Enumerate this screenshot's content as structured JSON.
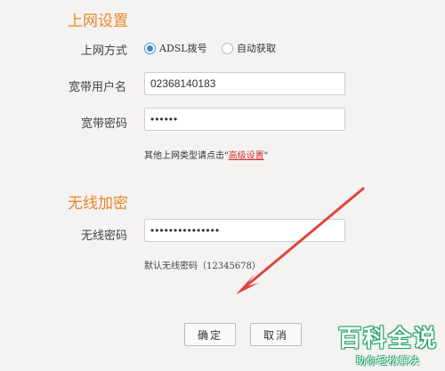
{
  "internet": {
    "title": "上网设置",
    "method_label": "上网方式",
    "option_adsl": "ADSL拨号",
    "option_auto": "自动获取",
    "selected": "ADSL拨号",
    "username_label": "宽带用户名",
    "username_value": "02368140183",
    "password_label": "宽带密码",
    "password_value": "••••••",
    "hint_prefix": "其他上网类型请点击\"",
    "hint_link": "高级设置",
    "hint_suffix": "\""
  },
  "wireless": {
    "title": "无线加密",
    "password_label": "无线密码",
    "password_value": "•••••••••••••••",
    "default_hint": "默认无线密码（12345678）"
  },
  "buttons": {
    "ok": "确定",
    "cancel": "取消"
  },
  "watermark": {
    "title": "百科全说",
    "subtitle": "助你轻松解决"
  },
  "colors": {
    "accent": "#e8872a",
    "arrow": "#e0443c",
    "link": "#d0342c"
  }
}
